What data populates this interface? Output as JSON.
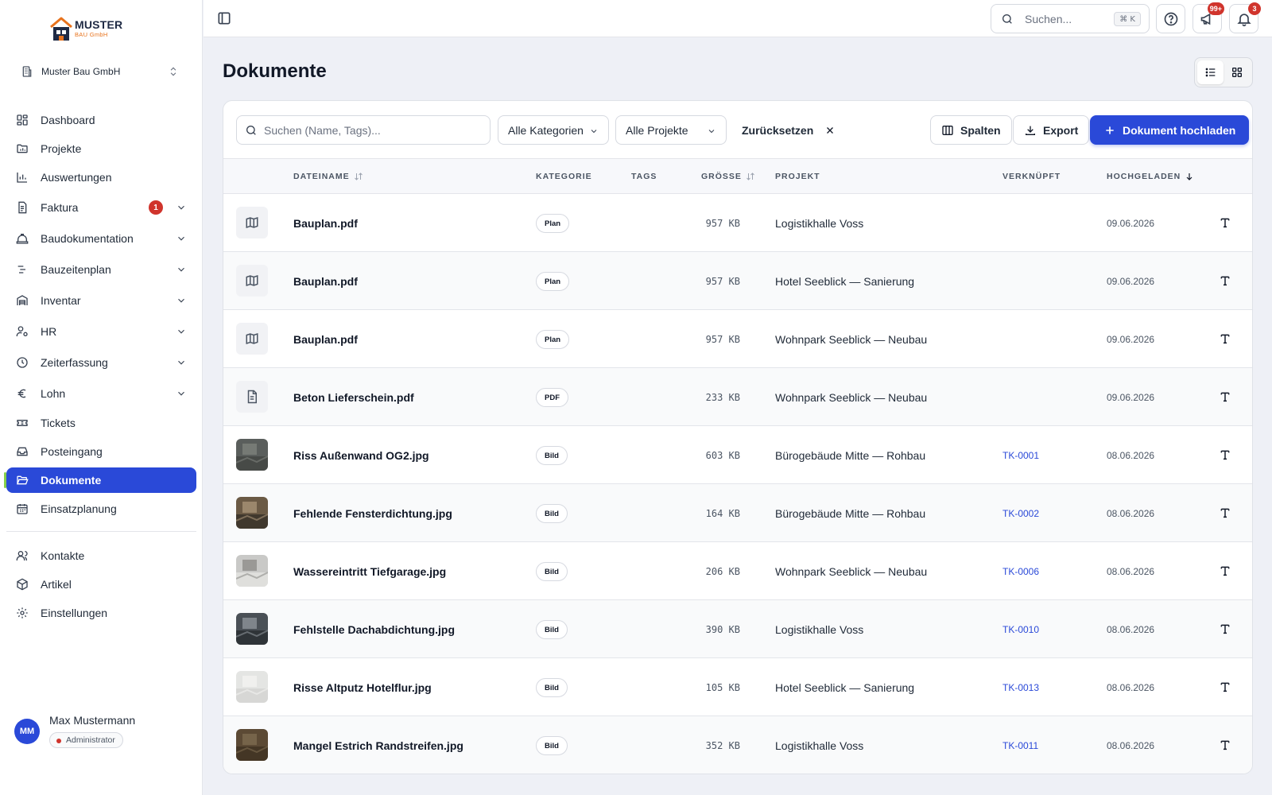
{
  "brand": {
    "title": "MUSTER",
    "subtitle": "BAU GmbH"
  },
  "company": {
    "name": "Muster Bau GmbH"
  },
  "nav": {
    "dashboard": "Dashboard",
    "projekte": "Projekte",
    "auswertungen": "Auswertungen",
    "faktura": "Faktura",
    "faktura_badge": "1",
    "baudokumentation": "Baudokumentation",
    "bauzeitenplan": "Bauzeitenplan",
    "inventar": "Inventar",
    "hr": "HR",
    "zeiterfassung": "Zeiterfassung",
    "lohn": "Lohn",
    "tickets": "Tickets",
    "posteingang": "Posteingang",
    "dokumente": "Dokumente",
    "einsatzplanung": "Einsatzplanung",
    "kontakte": "Kontakte",
    "artikel": "Artikel",
    "einstellungen": "Einstellungen"
  },
  "user": {
    "initials": "MM",
    "name": "Max Mustermann",
    "role": "Administrator"
  },
  "topbar": {
    "search_placeholder": "Suchen...",
    "shortcut": "⌘ K",
    "announcements_count": "99+",
    "notifications_count": "3"
  },
  "page": {
    "title": "Dokumente"
  },
  "toolbar": {
    "search_placeholder": "Suchen (Name, Tags)...",
    "category_filter": "Alle Kategorien",
    "project_filter": "Alle Projekte",
    "reset": "Zurücksetzen",
    "columns": "Spalten",
    "export": "Export",
    "upload": "Dokument hochladen"
  },
  "table": {
    "headers": {
      "filename": "DATEINAME",
      "category": "KATEGORIE",
      "tags": "TAGS",
      "size": "GRÖSSE",
      "project": "PROJEKT",
      "linked": "VERKNÜPFT",
      "uploaded": "HOCHGELADEN"
    },
    "rows": [
      {
        "name": "Bauplan.pdf",
        "category": "Plan",
        "size": "957 KB",
        "project": "Logistikhalle Voss",
        "linked": "",
        "date": "09.06.2026",
        "thumb": "map-icon"
      },
      {
        "name": "Bauplan.pdf",
        "category": "Plan",
        "size": "957 KB",
        "project": "Hotel Seeblick — Sanierung",
        "linked": "",
        "date": "09.06.2026",
        "thumb": "map-icon"
      },
      {
        "name": "Bauplan.pdf",
        "category": "Plan",
        "size": "957 KB",
        "project": "Wohnpark Seeblick — Neubau",
        "linked": "",
        "date": "09.06.2026",
        "thumb": "map-icon"
      },
      {
        "name": "Beton Lieferschein.pdf",
        "category": "PDF",
        "size": "233 KB",
        "project": "Wohnpark Seeblick — Neubau",
        "linked": "",
        "date": "09.06.2026",
        "thumb": "file-text-icon"
      },
      {
        "name": "Riss Außenwand OG2.jpg",
        "category": "Bild",
        "size": "603 KB",
        "project": "Bürogebäude Mitte — Rohbau",
        "linked": "TK-0001",
        "date": "08.06.2026",
        "thumb": "photo"
      },
      {
        "name": "Fehlende Fensterdichtung.jpg",
        "category": "Bild",
        "size": "164 KB",
        "project": "Bürogebäude Mitte — Rohbau",
        "linked": "TK-0002",
        "date": "08.06.2026",
        "thumb": "photo"
      },
      {
        "name": "Wassereintritt Tiefgarage.jpg",
        "category": "Bild",
        "size": "206 KB",
        "project": "Wohnpark Seeblick — Neubau",
        "linked": "TK-0006",
        "date": "08.06.2026",
        "thumb": "photo"
      },
      {
        "name": "Fehlstelle Dachabdichtung.jpg",
        "category": "Bild",
        "size": "390 KB",
        "project": "Logistikhalle Voss",
        "linked": "TK-0010",
        "date": "08.06.2026",
        "thumb": "photo"
      },
      {
        "name": "Risse Altputz Hotelflur.jpg",
        "category": "Bild",
        "size": "105 KB",
        "project": "Hotel Seeblick — Sanierung",
        "linked": "TK-0013",
        "date": "08.06.2026",
        "thumb": "photo"
      },
      {
        "name": "Mangel Estrich Randstreifen.jpg",
        "category": "Bild",
        "size": "352 KB",
        "project": "Logistikhalle Voss",
        "linked": "TK-0011",
        "date": "08.06.2026",
        "thumb": "photo"
      }
    ]
  },
  "colors": {
    "accent": "#2a49d8",
    "danger": "#d0342c",
    "brand_orange": "#e8731d",
    "active_marker": "#86d04a"
  }
}
